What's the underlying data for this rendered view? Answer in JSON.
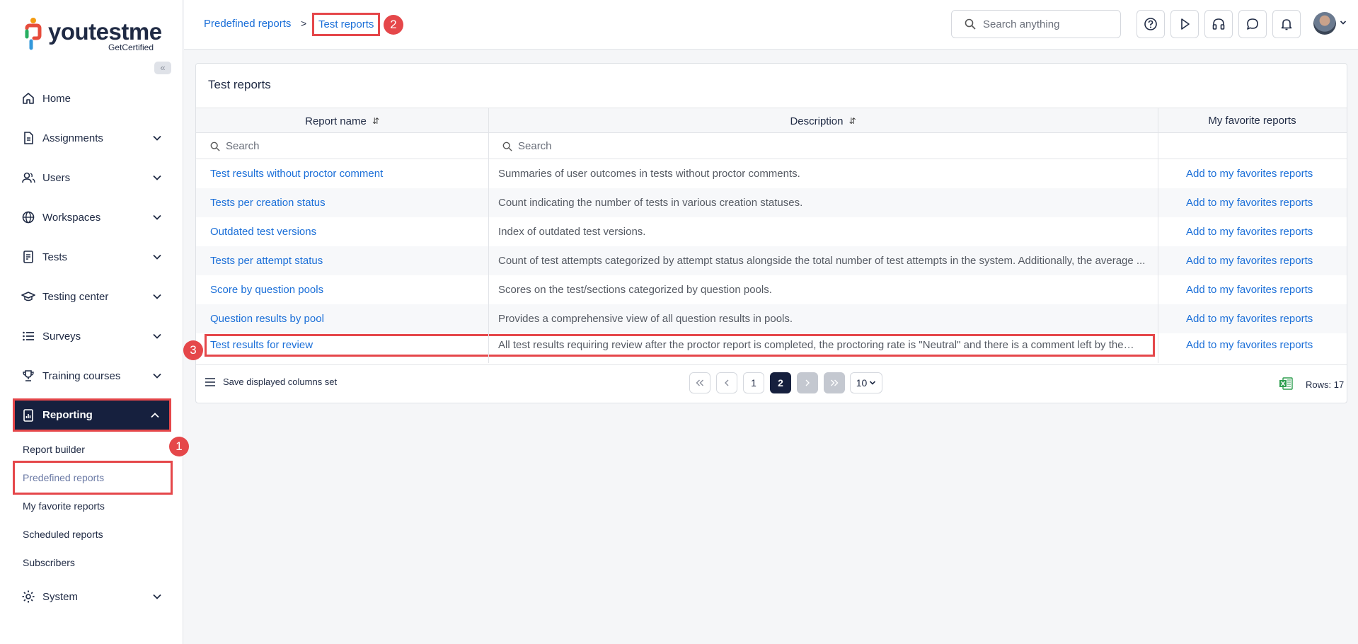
{
  "sidebar": {
    "logo_text": "youtestme",
    "logo_sub": "GetCertified",
    "collapse_label": "«",
    "items": [
      {
        "label": "Home",
        "icon": "home-icon"
      },
      {
        "label": "Assignments",
        "icon": "document-icon"
      },
      {
        "label": "Users",
        "icon": "users-icon"
      },
      {
        "label": "Workspaces",
        "icon": "globe-icon"
      },
      {
        "label": "Tests",
        "icon": "test-icon"
      },
      {
        "label": "Testing center",
        "icon": "graduation-cap-icon"
      },
      {
        "label": "Surveys",
        "icon": "list-icon"
      },
      {
        "label": "Training courses",
        "icon": "trophy-icon"
      },
      {
        "label": "Reporting",
        "icon": "report-icon"
      },
      {
        "label": "System",
        "icon": "gear-icon"
      }
    ],
    "reporting_sub": [
      "Report builder",
      "Predefined reports",
      "My favorite reports",
      "Scheduled reports",
      "Subscribers"
    ]
  },
  "header": {
    "breadcrumb_parent": "Predefined reports",
    "breadcrumb_sep": ">",
    "breadcrumb_current": "Test reports",
    "search_placeholder": "Search anything"
  },
  "badges": [
    "1",
    "2",
    "3"
  ],
  "panel": {
    "title": "Test reports",
    "columns": {
      "name": "Report name",
      "description": "Description",
      "favorites": "My favorite reports"
    },
    "sort_glyph": "⇵",
    "filter_placeholder": "Search",
    "rows": [
      {
        "name": "Test results without proctor comment",
        "description": "Summaries of user outcomes in tests without proctor comments.",
        "fav": "Add to my favorites reports"
      },
      {
        "name": "Tests per creation status",
        "description": "Count indicating the number of tests in various creation statuses.",
        "fav": "Add to my favorites reports"
      },
      {
        "name": "Outdated test versions",
        "description": "Index of outdated test versions.",
        "fav": "Add to my favorites reports"
      },
      {
        "name": "Tests per attempt status",
        "description": "Count of test attempts categorized by attempt status alongside the total number of test attempts in the system. Additionally, the average ...",
        "fav": "Add to my favorites reports"
      },
      {
        "name": "Score by question pools",
        "description": "Scores on the test/sections categorized by question pools.",
        "fav": "Add to my favorites reports"
      },
      {
        "name": "Question results by pool",
        "description": "Provides a comprehensive view of all question results in pools.",
        "fav": "Add to my favorites reports"
      },
      {
        "name": "Test results for review",
        "description": "All test results requiring review after the proctor report is completed, the proctoring rate is \"Neutral\" and there is a comment left by the pr...",
        "fav": "Add to my favorites reports"
      }
    ],
    "footer": {
      "save_columns": "Save displayed columns set",
      "pages": [
        "1",
        "2"
      ],
      "current_page": "2",
      "per_page": "10",
      "rows_label": "Rows: 17"
    }
  },
  "colors": {
    "accent": "#1b6fd8",
    "nav_dark": "#16203e",
    "highlight": "#e5474a"
  }
}
